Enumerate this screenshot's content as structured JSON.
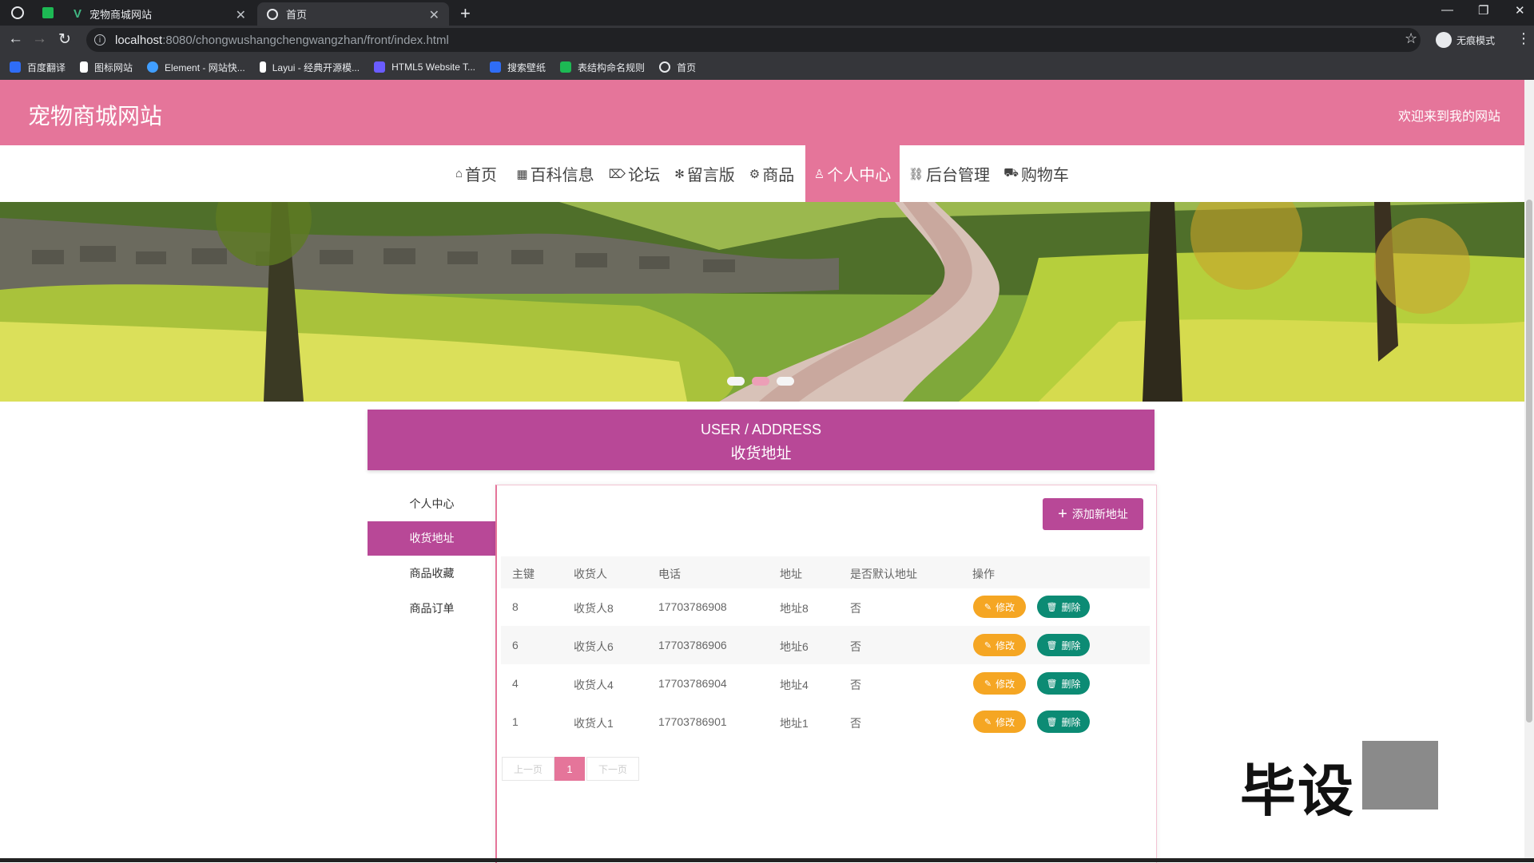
{
  "browser": {
    "tabs": [
      {
        "title": "宠物商城网站",
        "active": false
      },
      {
        "title": "首页",
        "active": true
      }
    ],
    "url_host": "localhost",
    "url_rest": ":8080/chongwushangchengwangzhan/front/index.html",
    "profile_label": "无痕模式",
    "bookmarks": [
      {
        "label": "百度翻译",
        "color": "#2f6df6"
      },
      {
        "label": "图标网站",
        "color": "#ffffff"
      },
      {
        "label": "Element - 网站快...",
        "color": "#409eff"
      },
      {
        "label": "Layui - 经典开源模...",
        "color": "#ffffff"
      },
      {
        "label": "HTML5 Website T...",
        "color": "#6a5cff"
      },
      {
        "label": "搜索壁纸",
        "color": "#2f6df6"
      },
      {
        "label": "表结构命名规则",
        "color": "#1db954"
      },
      {
        "label": "首页",
        "color": "#e8eaed"
      }
    ]
  },
  "site": {
    "title": "宠物商城网站",
    "welcome": "欢迎来到我的网站",
    "brand_color": "#e5759a",
    "accent_color": "#b84897",
    "nav": [
      {
        "icon": "home-icon",
        "glyph": "⌂",
        "label": "首页"
      },
      {
        "icon": "grid-icon",
        "glyph": "▦",
        "label": "百科信息"
      },
      {
        "icon": "tag-icon",
        "glyph": "⌦",
        "label": "论坛"
      },
      {
        "icon": "snowflake-icon",
        "glyph": "✻",
        "label": "留言版"
      },
      {
        "icon": "settings-icon",
        "glyph": "⚙",
        "label": "商品"
      },
      {
        "icon": "user-icon",
        "glyph": "♙",
        "label": "个人中心",
        "active": true
      },
      {
        "icon": "link-icon",
        "glyph": "⛓",
        "label": "后台管理"
      },
      {
        "icon": "cart-icon",
        "glyph": "🛒",
        "label": "购物车"
      }
    ]
  },
  "banner": {
    "active_slide_index": 1,
    "slide_count": 3
  },
  "section": {
    "title_en": "USER / ADDRESS",
    "title_cn": "收货地址"
  },
  "side_menu": [
    {
      "label": "个人中心",
      "active": false
    },
    {
      "label": "收货地址",
      "active": true
    },
    {
      "label": "商品收藏",
      "active": false
    },
    {
      "label": "商品订单",
      "active": false
    }
  ],
  "add_button_label": "添加新地址",
  "table": {
    "headers": [
      "主键",
      "收货人",
      "电话",
      "地址",
      "是否默认地址",
      "操作"
    ],
    "rows": [
      {
        "id": "8",
        "receiver": "收货人8",
        "phone": "17703786908",
        "address": "地址8",
        "is_default": "否"
      },
      {
        "id": "6",
        "receiver": "收货人6",
        "phone": "17703786906",
        "address": "地址6",
        "is_default": "否"
      },
      {
        "id": "4",
        "receiver": "收货人4",
        "phone": "17703786904",
        "address": "地址4",
        "is_default": "否"
      },
      {
        "id": "1",
        "receiver": "收货人1",
        "phone": "17703786901",
        "address": "地址1",
        "is_default": "否"
      }
    ],
    "edit_label": "修改",
    "delete_label": "删除"
  },
  "pagination": {
    "prev": "上一页",
    "current": "1",
    "next": "下一页"
  },
  "watermark": "毕设"
}
